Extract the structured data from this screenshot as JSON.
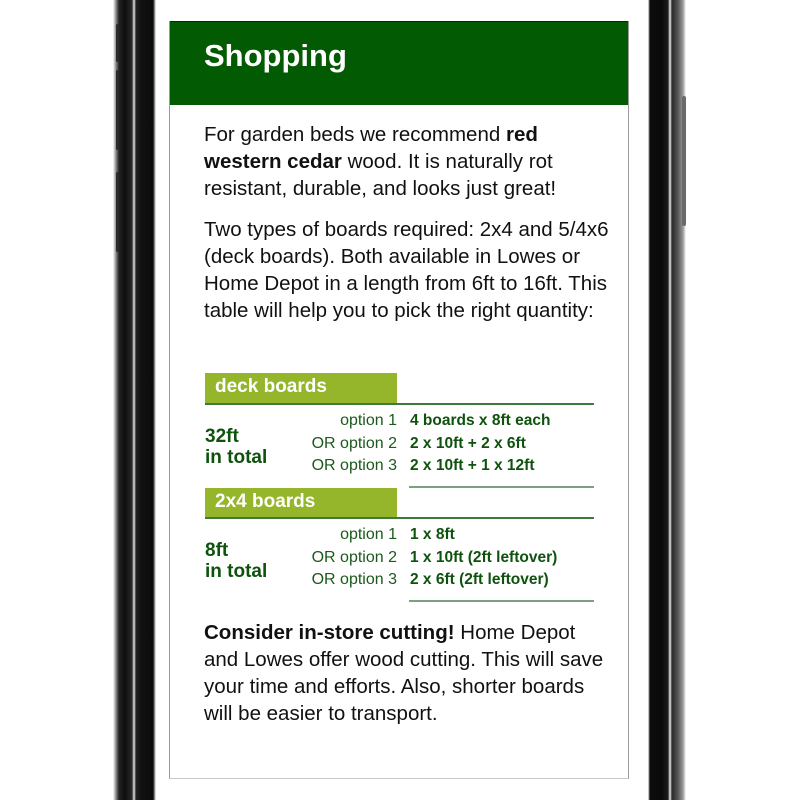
{
  "header": {
    "title": "Shopping"
  },
  "intro": {
    "before_bold": "For garden beds we recommend ",
    "bold": "red western cedar",
    "after_bold": " wood. It is naturally rot resistant, durable, and looks just great!"
  },
  "boards_info": "Two types of boards required: 2x4 and 5/4x6 (deck boards). Both available in Lowes or Home Depot in a length from 6ft to 16ft. This table will help you to pick the right quantity:",
  "table": {
    "sections": [
      {
        "title": "deck boards",
        "total_amount": "32ft",
        "total_suffix": "in total",
        "options": [
          {
            "label": "option 1",
            "value": "4 boards x 8ft each"
          },
          {
            "label": "OR option 2",
            "value": "2 x 10ft + 2 x 6ft"
          },
          {
            "label": "OR option 3",
            "value": "2 x 10ft + 1 x 12ft"
          }
        ]
      },
      {
        "title": "2x4 boards",
        "total_amount": "8ft",
        "total_suffix": "in total",
        "options": [
          {
            "label": "option 1",
            "value": "1 x 8ft"
          },
          {
            "label": "OR option 2",
            "value": "1 x 10ft (2ft leftover)"
          },
          {
            "label": "OR option 3",
            "value": "2 x 6ft (2ft leftover)"
          }
        ]
      }
    ]
  },
  "tip": {
    "bold": "Consider in-store cutting!",
    "text": " Home Depot and Lowes offer wood cutting. This will save your time and efforts. Also, shorter boards will be easier to transport."
  },
  "colors": {
    "header_bg": "#025a02",
    "section_header_bg": "#95b52a",
    "table_text": "#0e520e"
  }
}
